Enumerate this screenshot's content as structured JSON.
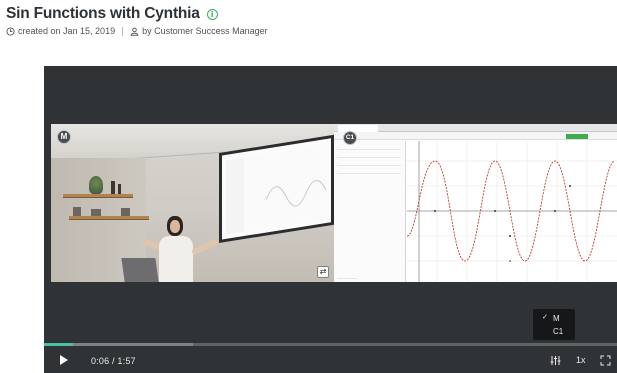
{
  "header": {
    "title": "Sin Functions with Cynthia",
    "created": "created on Jan 15, 2019",
    "author": "by Customer Success Manager"
  },
  "player": {
    "camera_badge": "M",
    "screen_badge": "C1",
    "time": "0:06 / 1:57",
    "speed": "1x",
    "progress_fraction": 0.051,
    "buffered_fraction": 0.26,
    "track_menu": {
      "items": [
        {
          "label": "M",
          "selected": true
        },
        {
          "label": "C1",
          "selected": false
        }
      ]
    }
  },
  "colors": {
    "accent_green": "#3dae5f",
    "progress_fill": "#48c1a2",
    "player_bg": "#2f3335"
  },
  "icons": {
    "info": "info-icon",
    "clock": "clock-icon",
    "user": "user-icon",
    "play": "play-icon",
    "tracks": "tracks-icon",
    "fullscreen": "fullscreen-icon",
    "swap": "swap-view-icon"
  }
}
